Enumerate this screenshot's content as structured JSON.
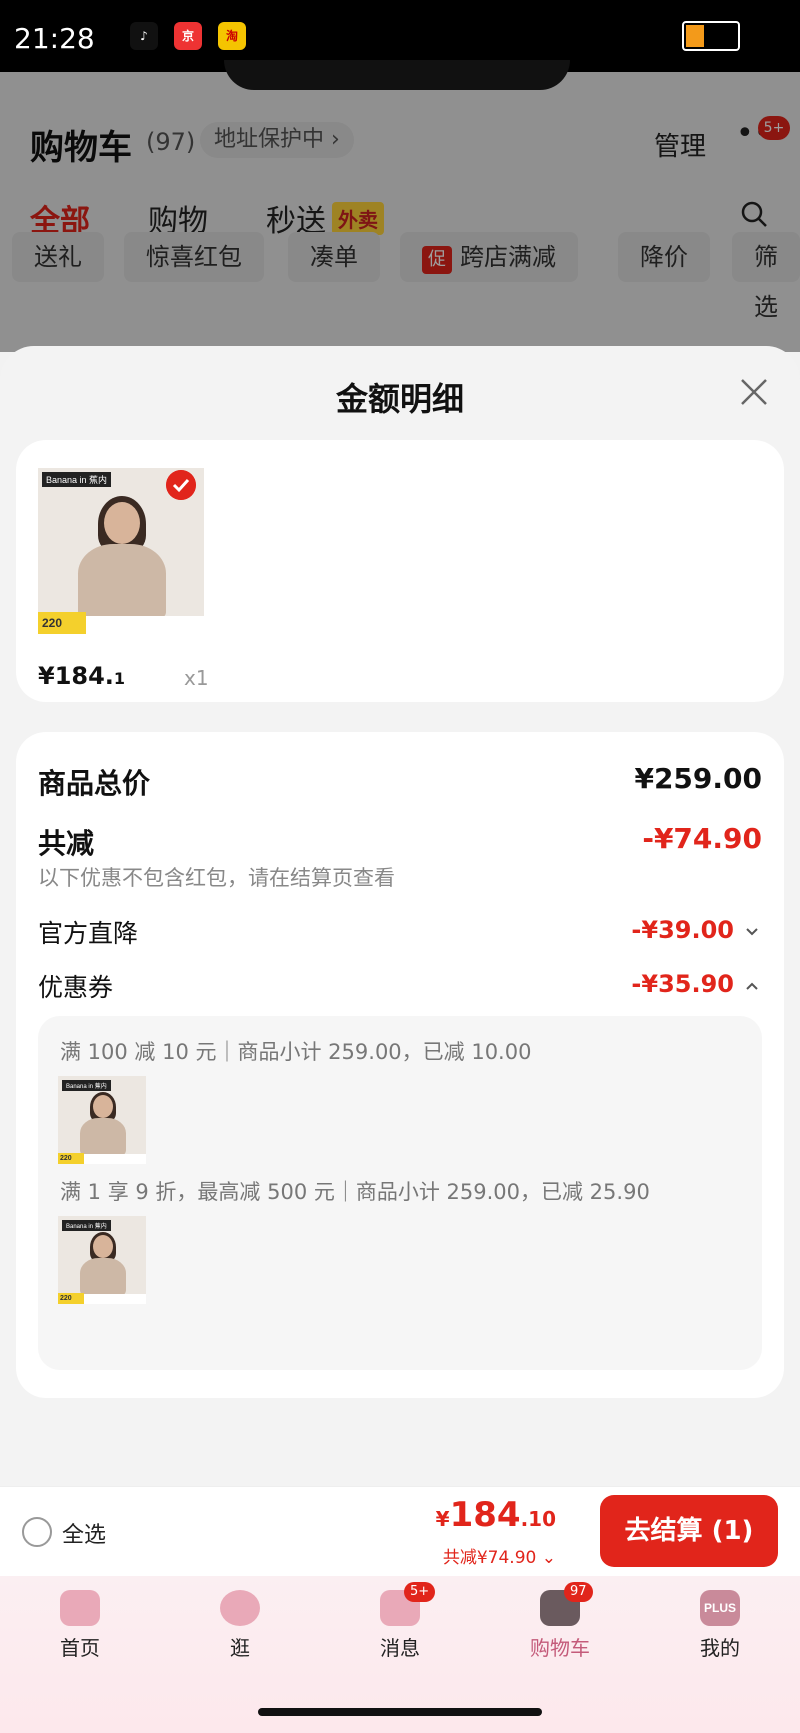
{
  "status_bar": {
    "time": "21:28",
    "apps": [
      "tiktok-icon",
      "jd-icon",
      "taobao-icon"
    ]
  },
  "cart_header": {
    "title": "购物车",
    "count": "(97)",
    "address_label": "地址保护中",
    "manage_label": "管理",
    "more_badge": "5+"
  },
  "cart_tabs": [
    {
      "label": "全部"
    },
    {
      "label": "购物"
    },
    {
      "label": "秒送"
    }
  ],
  "waimai_tag": "外卖",
  "filter_chips": [
    {
      "label": "送礼"
    },
    {
      "label": "惊喜红包"
    },
    {
      "label": "凑单"
    },
    {
      "label": "跨店满减",
      "badge": "促"
    },
    {
      "label": "降价"
    },
    {
      "label": "筛选"
    }
  ],
  "sheet": {
    "title": "金额明细",
    "item": {
      "brand": "Banana in 蕉内",
      "tag_price": "220",
      "price_main": "¥184.",
      "price_decimal": "1",
      "quantity": "x1"
    },
    "summary": {
      "total_label": "商品总价",
      "total_value": "¥259.00",
      "discount_label": "共减",
      "discount_value": "-¥74.90",
      "discount_note": "以下优惠不包含红包，请在结算页查看",
      "official_label": "官方直降",
      "official_value": "-¥39.00",
      "coupon_label": "优惠券",
      "coupon_value": "-¥35.90"
    },
    "coupons": [
      {
        "text": "满 100 减 10 元｜商品小计 259.00，已减 10.00"
      },
      {
        "text": "满 1 享 9 折，最高减 500 元｜商品小计 259.00，已减 25.90"
      }
    ]
  },
  "checkout": {
    "select_all": "全选",
    "yen": "¥",
    "total_big": "184",
    "total_dec": ".10",
    "discount_text": "共减¥74.90",
    "button_label": "去结算 (1)"
  },
  "tabbar": [
    {
      "label": "首页",
      "icon": "home-icon"
    },
    {
      "label": "逛",
      "icon": "explore-icon"
    },
    {
      "label": "消息",
      "icon": "message-icon",
      "badge": "5+"
    },
    {
      "label": "购物车",
      "icon": "cart-icon",
      "badge": "97"
    },
    {
      "label": "我的",
      "icon": "plus-icon",
      "icon_text": "PLUS"
    }
  ],
  "colors": {
    "accent": "#e1251b",
    "tab_active": "#c45b7a"
  }
}
